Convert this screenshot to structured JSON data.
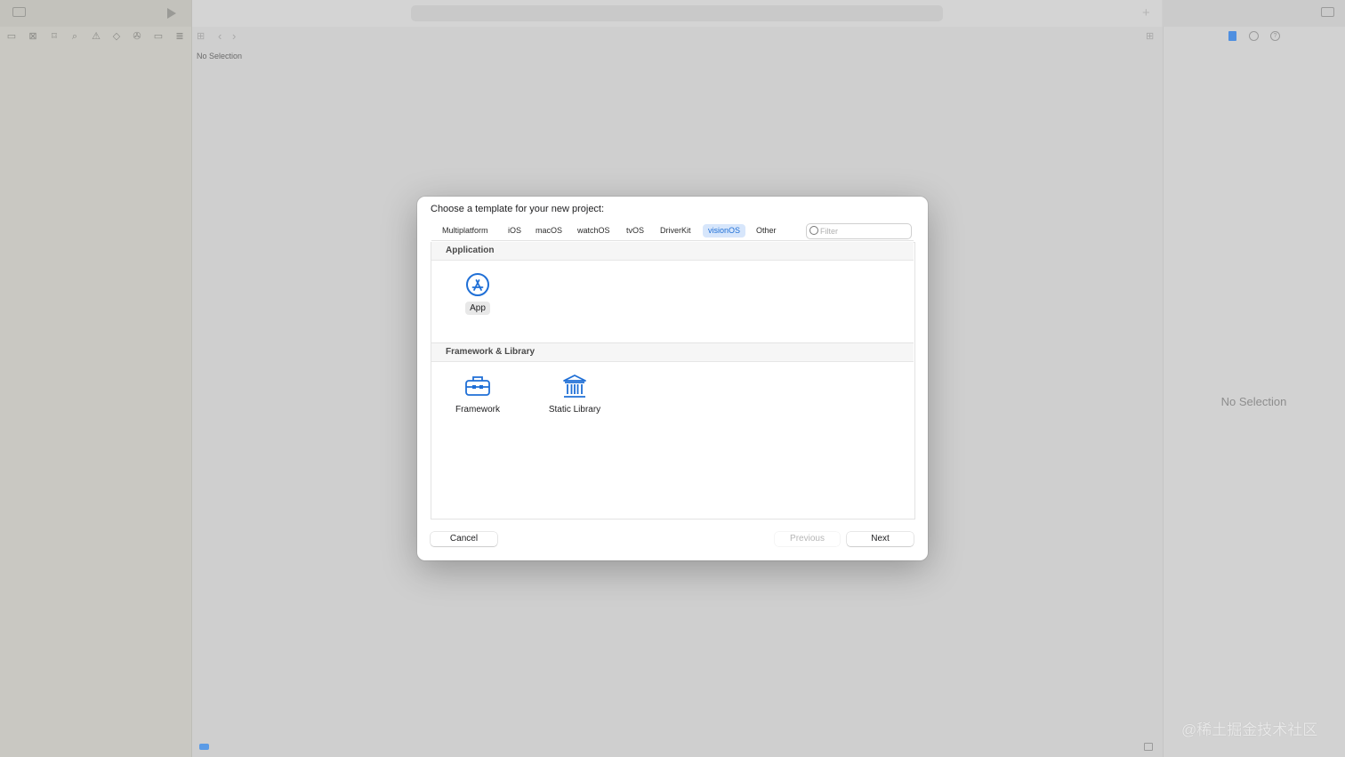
{
  "editor": {
    "no_selection": "No Selection"
  },
  "inspector": {
    "no_selection": "No Selection"
  },
  "dialog": {
    "title": "Choose a template for your new project:",
    "platforms": [
      {
        "label": "Multiplatform",
        "selected": false
      },
      {
        "label": "iOS",
        "selected": false
      },
      {
        "label": "macOS",
        "selected": false
      },
      {
        "label": "watchOS",
        "selected": false
      },
      {
        "label": "tvOS",
        "selected": false
      },
      {
        "label": "DriverKit",
        "selected": false
      },
      {
        "label": "visionOS",
        "selected": true
      },
      {
        "label": "Other",
        "selected": false
      }
    ],
    "filter": {
      "placeholder": "Filter",
      "value": ""
    },
    "sections": [
      {
        "header": "Application",
        "templates": [
          {
            "label": "App",
            "icon": "app-store-icon",
            "selected": true
          }
        ]
      },
      {
        "header": "Framework & Library",
        "templates": [
          {
            "label": "Framework",
            "icon": "toolbox-icon",
            "selected": false
          },
          {
            "label": "Static Library",
            "icon": "library-columns-icon",
            "selected": false
          }
        ]
      }
    ],
    "buttons": {
      "cancel": "Cancel",
      "previous": "Previous",
      "next": "Next"
    }
  },
  "watermark": "@稀土掘金技术社区",
  "colors": {
    "accent": "#1f6fd6",
    "selected_tab_bg": "#d7e6fb"
  }
}
